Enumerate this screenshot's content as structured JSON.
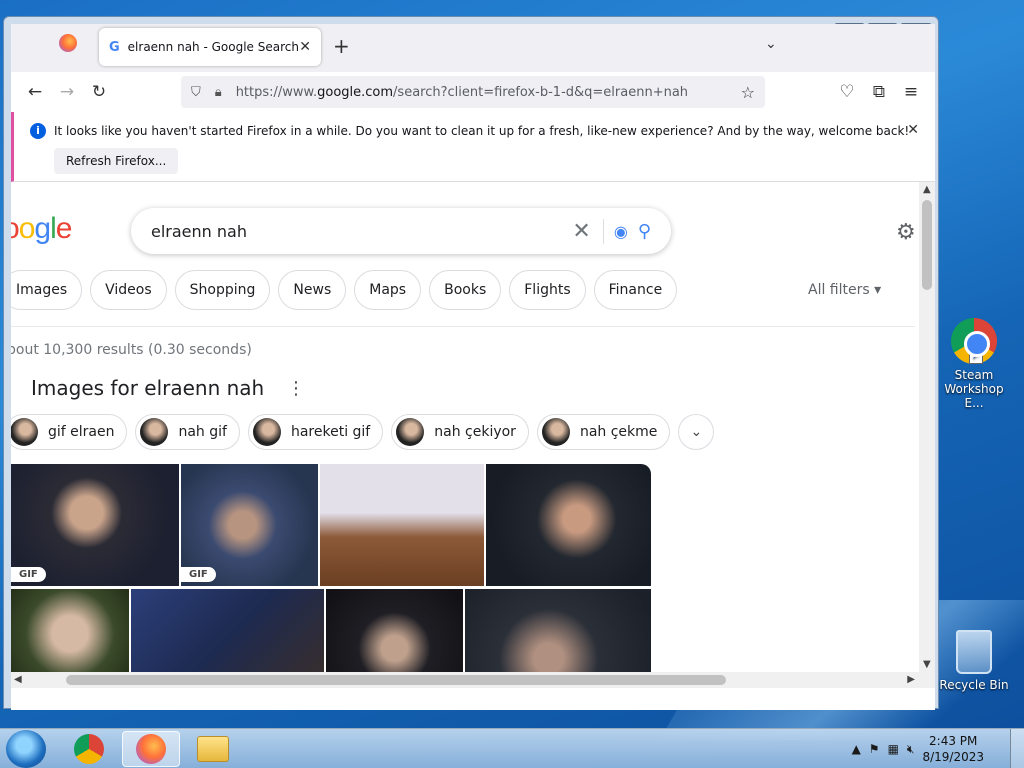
{
  "desktop": {
    "icons": [
      {
        "label": "Steam Workshop E...",
        "icon": "chrome-shortcut-icon"
      },
      {
        "label": "Recycle Bin",
        "icon": "recycle-bin-icon"
      }
    ]
  },
  "window": {
    "controls": {
      "minimize": "▬",
      "maximize": "▭",
      "close": "✕"
    }
  },
  "browser": {
    "tab": {
      "favicon": "G",
      "title": "elraenn nah - Google Search",
      "close": "✕"
    },
    "new_tab": "+",
    "tab_list": "⌄",
    "nav": {
      "back": "←",
      "forward": "→",
      "reload": "↻"
    },
    "url": {
      "prefix": "https://www.",
      "host": "google.com",
      "path": "/search?client=firefox-b-1-d&q=elraenn+nah"
    },
    "toolbar_icons": [
      "pocket-icon",
      "extensions-icon",
      "menu-icon"
    ],
    "notification": {
      "message": "It looks like you haven't started Firefox in a while. Do you want to clean it up for a fresh, like-new experience? And by the way, welcome back!",
      "button": "Refresh Firefox..."
    }
  },
  "google": {
    "logo": [
      "o",
      "o",
      "g",
      "l",
      "e"
    ],
    "logo_colors": [
      "#ea4335",
      "#fbbc05",
      "#4285f4",
      "#34a853",
      "#ea4335"
    ],
    "query": "elraenn nah",
    "tabs": [
      "Images",
      "Videos",
      "Shopping",
      "News",
      "Maps",
      "Books",
      "Flights",
      "Finance"
    ],
    "all_filters": "All filters",
    "stats": "bout 10,300 results (0.30 seconds)",
    "images_heading": "Images for elraenn nah",
    "related": [
      "gif elraen",
      "nah gif",
      "hareketi gif",
      "nah çekiyor",
      "nah çekme"
    ],
    "gif_badge": "GIF"
  },
  "taskbar": {
    "time": "2:43 PM",
    "date": "8/19/2023"
  }
}
